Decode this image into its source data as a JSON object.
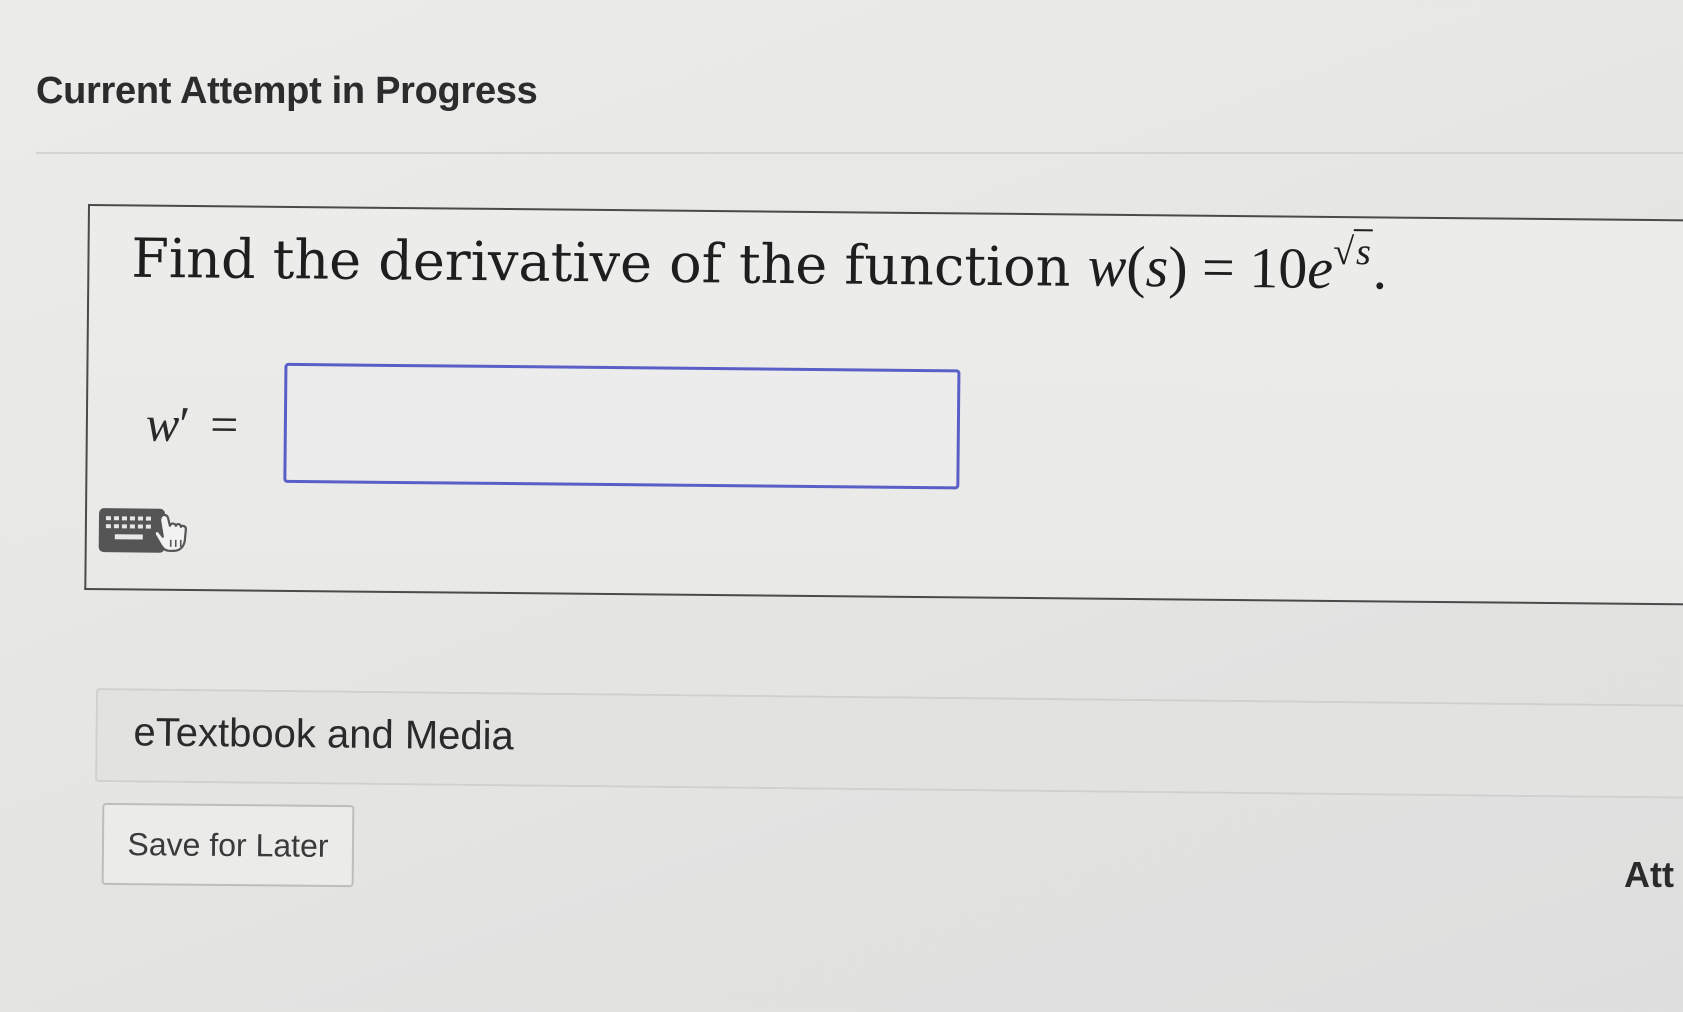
{
  "page": {
    "heading": "Current Attempt in Progress"
  },
  "question": {
    "prompt_text": "Find the derivative of the function ",
    "func_name": "w",
    "func_arg": "s",
    "equals": "=",
    "coefficient": "10",
    "base": "e",
    "radicand": "s",
    "end_punct": ".",
    "answer_var": "w",
    "answer_prime": "′",
    "answer_equals": "=",
    "answer_value": "",
    "answer_placeholder": ""
  },
  "icons": {
    "keyboard": "keyboard-icon",
    "pointer": "hand-pointer-icon"
  },
  "resources": {
    "etextbook_label": "eTextbook and Media"
  },
  "actions": {
    "save_label": "Save for Later",
    "cutoff_label": "Att"
  },
  "colors": {
    "input_border": "#5a5fc8",
    "keyboard_icon": "#555555"
  }
}
